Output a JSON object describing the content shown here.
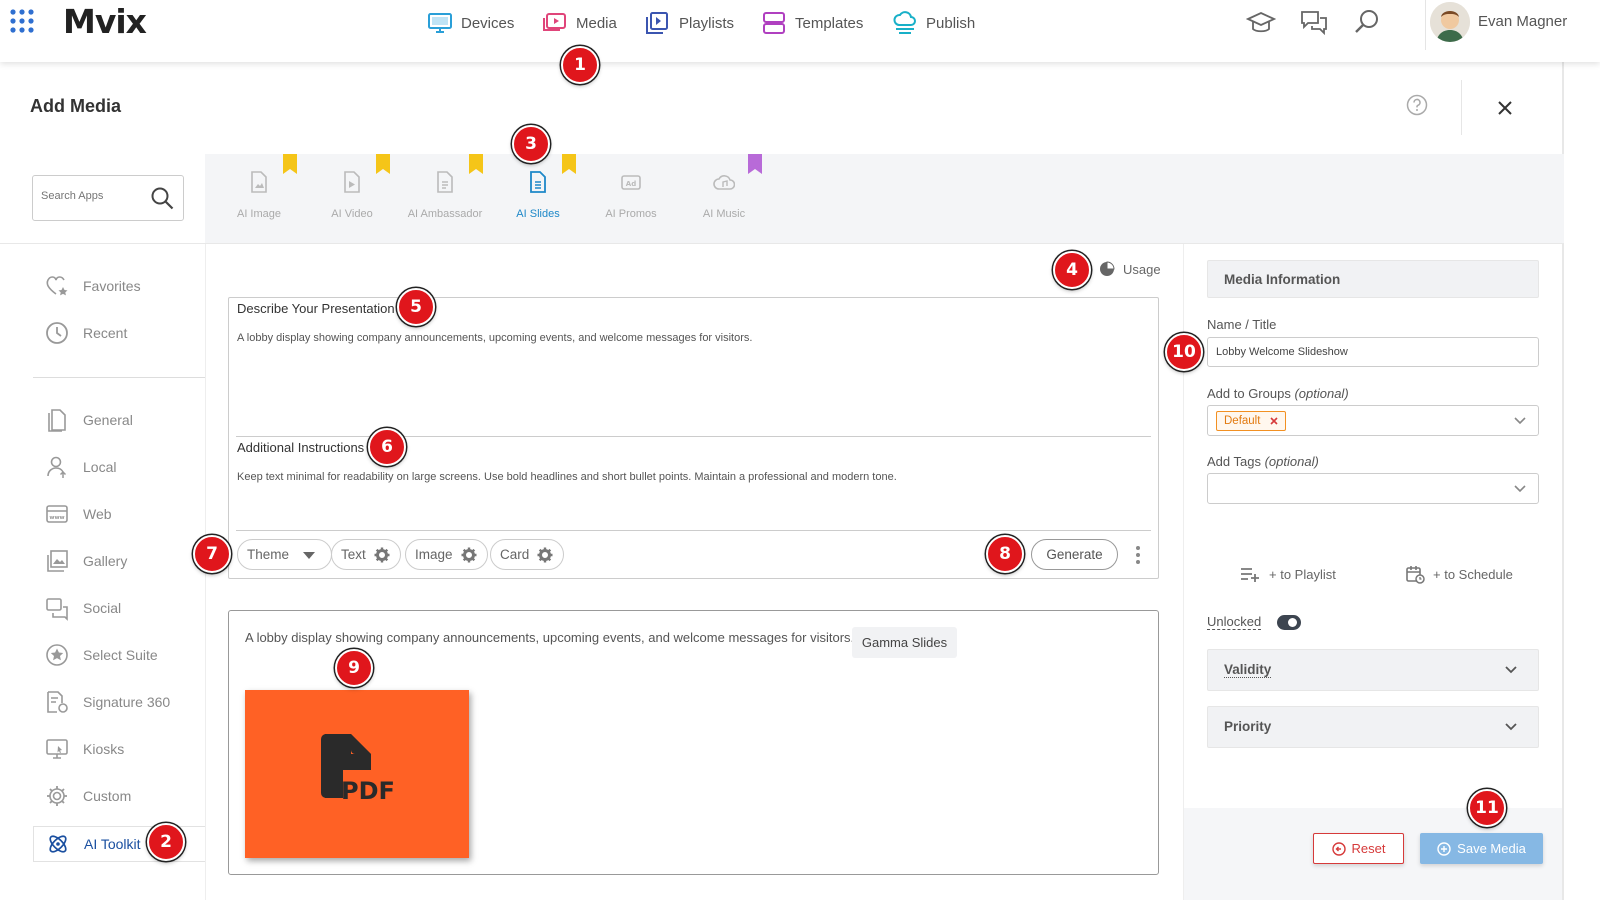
{
  "app": {
    "logo": "Mvix",
    "user_name": "Evan Magner"
  },
  "nav": {
    "items": [
      {
        "label": "Devices",
        "icon": "monitor-icon"
      },
      {
        "label": "Media",
        "icon": "media-play-icon"
      },
      {
        "label": "Playlists",
        "icon": "playlist-icon"
      },
      {
        "label": "Templates",
        "icon": "templates-icon"
      },
      {
        "label": "Publish",
        "icon": "cloud-publish-icon"
      }
    ],
    "right_icons": [
      "graduation-cap-icon",
      "chat-icon",
      "search-icon"
    ]
  },
  "header": {
    "title": "Add Media"
  },
  "search": {
    "placeholder": "Search Apps"
  },
  "app_tabs": [
    {
      "label": "AI Image",
      "ribbon": "yellow"
    },
    {
      "label": "AI Video",
      "ribbon": "yellow"
    },
    {
      "label": "AI Ambassador",
      "ribbon": "yellow"
    },
    {
      "label": "AI Slides",
      "ribbon": "yellow",
      "active": true
    },
    {
      "label": "AI Promos",
      "ribbon": "none"
    },
    {
      "label": "AI Music",
      "ribbon": "purple"
    }
  ],
  "sidebar": {
    "items": [
      {
        "label": "Favorites",
        "icon": "heart-star-icon"
      },
      {
        "label": "Recent",
        "icon": "clock-icon"
      },
      {
        "label": "General",
        "icon": "file-icon"
      },
      {
        "label": "Local",
        "icon": "user-upload-icon"
      },
      {
        "label": "Web",
        "icon": "web-icon"
      },
      {
        "label": "Gallery",
        "icon": "gallery-icon"
      },
      {
        "label": "Social",
        "icon": "social-icon"
      },
      {
        "label": "Select Suite",
        "icon": "star-circle-icon"
      },
      {
        "label": "Signature 360",
        "icon": "signature-icon"
      },
      {
        "label": "Kiosks",
        "icon": "kiosk-icon"
      },
      {
        "label": "Custom",
        "icon": "gear-icon"
      },
      {
        "label": "AI Toolkit",
        "icon": "atom-icon",
        "active": true
      }
    ]
  },
  "usage": {
    "label": "Usage"
  },
  "prompt": {
    "describe_label": "Describe Your Presentation",
    "describe_value": "A lobby display showing company announcements, upcoming events, and welcome messages for visitors.",
    "instructions_label": "Additional Instructions",
    "instructions_value": "Keep text minimal for readability on large screens. Use bold headlines and short bullet points. Maintain a professional and modern tone.",
    "chips": [
      {
        "label": "Theme",
        "icon": "caret-down-icon"
      },
      {
        "label": "Text",
        "icon": "gear-icon"
      },
      {
        "label": "Image",
        "icon": "gear-icon"
      },
      {
        "label": "Card",
        "icon": "gear-icon"
      }
    ],
    "generate_label": "Generate"
  },
  "output": {
    "description": "A lobby display showing company announcements, upcoming events, and welcome messages for visitors.",
    "source_label": "Gamma Slides",
    "file_type": "PDF",
    "tile_color": "#ff6125"
  },
  "media_info": {
    "section_title": "Media Information",
    "name_label": "Name / Title",
    "name_value": "Lobby Welcome Slideshow",
    "groups_label": "Add to Groups",
    "groups_optional": "(optional)",
    "group_tag": "Default",
    "tags_label": "Add Tags",
    "tags_optional": "(optional)",
    "to_playlist": "+ to Playlist",
    "to_schedule": "+ to Schedule",
    "unlocked_label": "Unlocked",
    "unlocked_on": true,
    "validity_label": "Validity",
    "priority_label": "Priority"
  },
  "footer": {
    "reset_label": "Reset",
    "save_label": "Save Media"
  },
  "annotations": [
    "1",
    "2",
    "3",
    "4",
    "5",
    "6",
    "7",
    "8",
    "9",
    "10",
    "11"
  ],
  "colors": {
    "accent_blue": "#1e88c8",
    "badge_red": "#e0161c",
    "save_button": "#86b8e4",
    "reset_red": "#d63a3a",
    "tag_orange": "#f29022"
  }
}
